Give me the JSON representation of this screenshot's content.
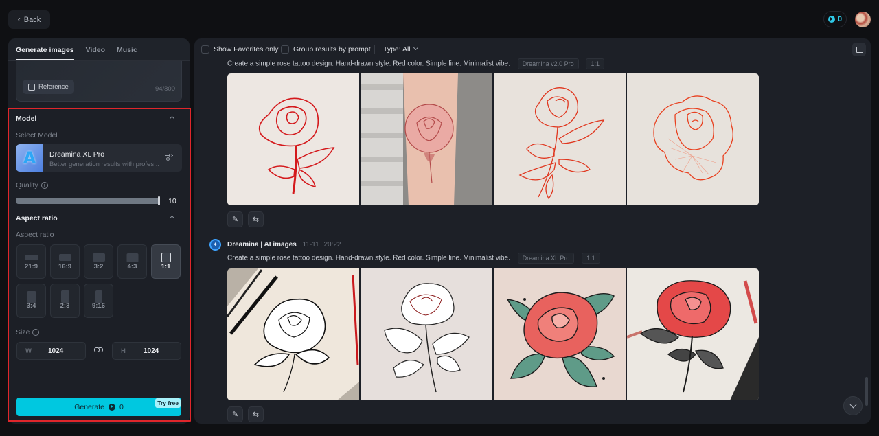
{
  "topbar": {
    "back_label": "Back",
    "credits": "0"
  },
  "left_panel": {
    "tabs": [
      {
        "label": "Generate images",
        "active": true
      },
      {
        "label": "Video",
        "active": false
      },
      {
        "label": "Music",
        "active": false
      }
    ],
    "prompt": {
      "reference_label": "Reference",
      "char_count": "94/800"
    },
    "model_section": {
      "title": "Model",
      "select_label": "Select Model",
      "model_name": "Dreamina XL Pro",
      "model_desc": "Better generation results with profes...",
      "model_thumb_glyph": "A"
    },
    "quality": {
      "label": "Quality",
      "value": "10",
      "fraction": 1.0
    },
    "aspect_section": {
      "title": "Aspect ratio",
      "sub_label": "Aspect ratio",
      "options": [
        {
          "label": "21:9",
          "selected": false
        },
        {
          "label": "16:9",
          "selected": false
        },
        {
          "label": "3:2",
          "selected": false
        },
        {
          "label": "4:3",
          "selected": false
        },
        {
          "label": "1:1",
          "selected": true
        },
        {
          "label": "3:4",
          "selected": false
        },
        {
          "label": "2:3",
          "selected": false
        },
        {
          "label": "9:16",
          "selected": false
        }
      ]
    },
    "size": {
      "label": "Size",
      "width_tag": "W",
      "width_value": "1024",
      "height_tag": "H",
      "height_value": "1024"
    },
    "generate": {
      "label": "Generate",
      "cost": "0",
      "badge": "Try free"
    },
    "highlight_color": "#e0262b",
    "accent_color": "#00c8e0"
  },
  "main_panel": {
    "toolbar": {
      "favorites_label": "Show Favorites only",
      "group_label": "Group results by prompt",
      "type_label": "Type: All"
    },
    "generations": [
      {
        "author": "",
        "date": "",
        "time": "",
        "prompt": "Create a simple rose tattoo design. Hand-drawn style. Red color. Simple line. Minimalist vibe.",
        "model_chip": "Dreamina v2.0 Pro",
        "ratio_chip": "1:1",
        "images": [
          "red line-art rose on paper",
          "pink rose tattoo on forearm",
          "red line rose with leaves",
          "red hatched rose bloom"
        ]
      },
      {
        "author": "Dreamina | AI images",
        "date": "11-11",
        "time": "20:22",
        "prompt": "Create a simple rose tattoo design. Hand-drawn style. Red color. Simple line. Minimalist vibe.",
        "model_chip": "Dreamina XL Pro",
        "ratio_chip": "1:1",
        "images": [
          "black ink rose sketch with pens",
          "black line rose with red center",
          "red rose with green leaves tattoo flash",
          "red rose with grey leaves and pencils"
        ]
      }
    ]
  }
}
